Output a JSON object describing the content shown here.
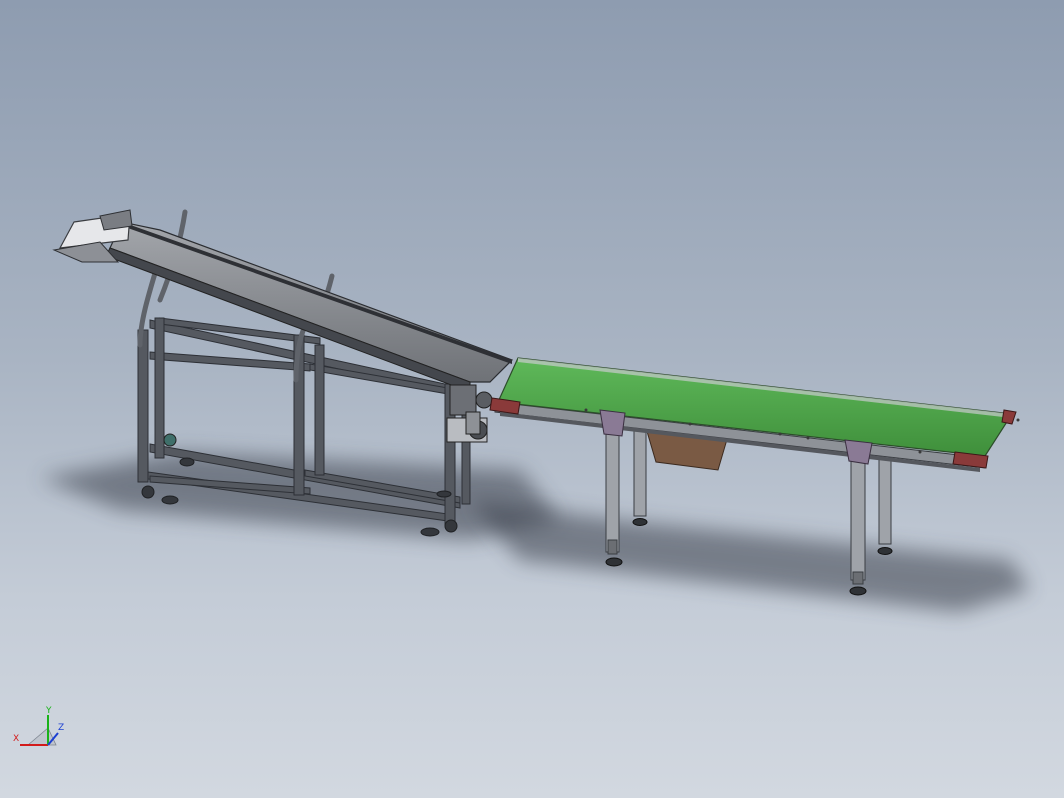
{
  "scene": {
    "description_free": true,
    "colors": {
      "background_top": "#8e9cb0",
      "background_bottom": "#d2d8e0",
      "belt_green": "#4fa84a",
      "frame_dark": "#3a3d44",
      "frame_mid": "#6f737b",
      "inclined_belt": "#8c8f95",
      "end_cap_red": "#8a3a3a",
      "bracket_purple": "#8a7a95",
      "box_brown": "#7a5a44",
      "shadow": "#3b414b"
    }
  },
  "triad": {
    "x_label": "X",
    "y_label": "Y",
    "z_label": "Z",
    "x_color": "#d21b1b",
    "y_color": "#19b219",
    "z_color": "#1b3fd2"
  }
}
